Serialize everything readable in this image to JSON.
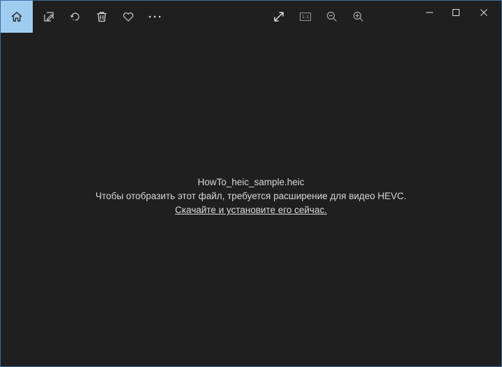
{
  "toolbar": {
    "left_icons": [
      "home-icon",
      "edit-icon",
      "rotate-icon",
      "delete-icon",
      "favorite-icon",
      "more-icon"
    ],
    "right_icons": [
      "fullscreen-icon",
      "actual-size-icon",
      "zoom-out-icon",
      "zoom-in-icon"
    ],
    "actual_size_label": "1:1",
    "accent_color": "#9fcdf0"
  },
  "window_controls": [
    "minimize-icon",
    "maximize-icon",
    "close-icon"
  ],
  "viewer": {
    "file_name": "HowTo_heic_sample.heic",
    "message": "Чтобы отобразить этот файл, требуется расширение для видео HEVC.",
    "link_text": "Скачайте и установите его сейчас."
  }
}
